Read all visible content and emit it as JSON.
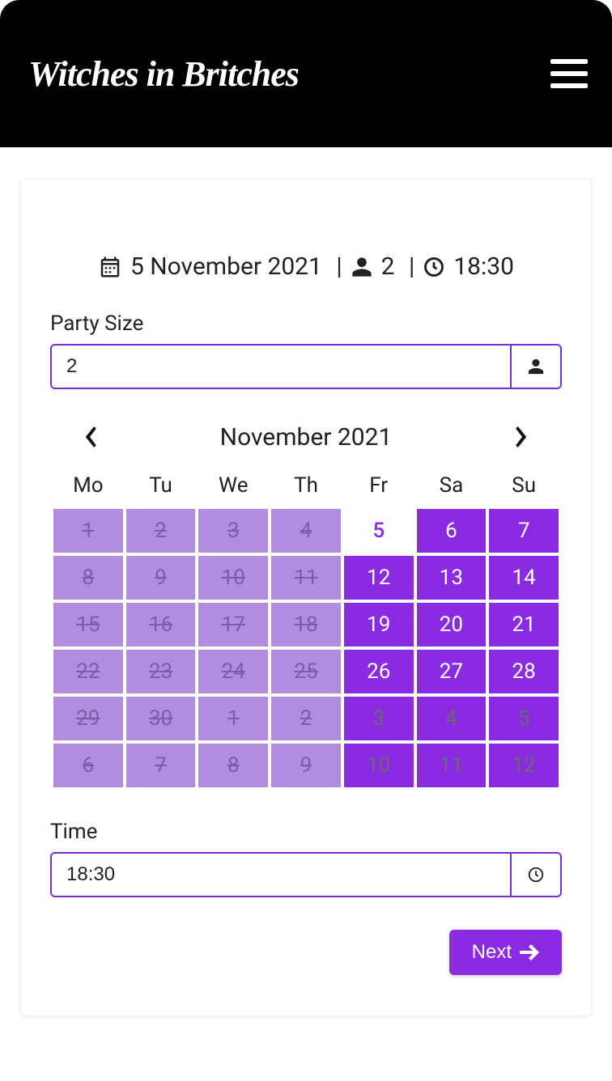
{
  "header": {
    "logo_text": "Witches in Britches"
  },
  "summary": {
    "date": "5 November 2021",
    "party": "2",
    "time": "18:30"
  },
  "party_size": {
    "label": "Party Size",
    "value": "2"
  },
  "calendar": {
    "title": "November 2021",
    "dow": [
      "Mo",
      "Tu",
      "We",
      "Th",
      "Fr",
      "Sa",
      "Su"
    ],
    "cells": [
      {
        "d": "1",
        "state": "disabled"
      },
      {
        "d": "2",
        "state": "disabled"
      },
      {
        "d": "3",
        "state": "disabled"
      },
      {
        "d": "4",
        "state": "disabled"
      },
      {
        "d": "5",
        "state": "selected"
      },
      {
        "d": "6",
        "state": "available"
      },
      {
        "d": "7",
        "state": "available"
      },
      {
        "d": "8",
        "state": "disabled"
      },
      {
        "d": "9",
        "state": "disabled"
      },
      {
        "d": "10",
        "state": "disabled"
      },
      {
        "d": "11",
        "state": "disabled"
      },
      {
        "d": "12",
        "state": "available"
      },
      {
        "d": "13",
        "state": "available"
      },
      {
        "d": "14",
        "state": "available"
      },
      {
        "d": "15",
        "state": "disabled"
      },
      {
        "d": "16",
        "state": "disabled"
      },
      {
        "d": "17",
        "state": "disabled"
      },
      {
        "d": "18",
        "state": "disabled"
      },
      {
        "d": "19",
        "state": "available"
      },
      {
        "d": "20",
        "state": "available"
      },
      {
        "d": "21",
        "state": "available"
      },
      {
        "d": "22",
        "state": "disabled"
      },
      {
        "d": "23",
        "state": "disabled"
      },
      {
        "d": "24",
        "state": "disabled"
      },
      {
        "d": "25",
        "state": "disabled"
      },
      {
        "d": "26",
        "state": "available"
      },
      {
        "d": "27",
        "state": "available"
      },
      {
        "d": "28",
        "state": "available"
      },
      {
        "d": "29",
        "state": "disabled"
      },
      {
        "d": "30",
        "state": "disabled"
      },
      {
        "d": "1",
        "state": "disabled"
      },
      {
        "d": "2",
        "state": "disabled"
      },
      {
        "d": "3",
        "state": "next-month-available"
      },
      {
        "d": "4",
        "state": "next-month-available"
      },
      {
        "d": "5",
        "state": "next-month-available"
      },
      {
        "d": "6",
        "state": "disabled"
      },
      {
        "d": "7",
        "state": "disabled"
      },
      {
        "d": "8",
        "state": "disabled"
      },
      {
        "d": "9",
        "state": "disabled"
      },
      {
        "d": "10",
        "state": "next-month-available"
      },
      {
        "d": "11",
        "state": "next-month-available"
      },
      {
        "d": "12",
        "state": "next-month-available"
      }
    ]
  },
  "time": {
    "label": "Time",
    "value": "18:30"
  },
  "footer": {
    "next_label": "Next"
  }
}
